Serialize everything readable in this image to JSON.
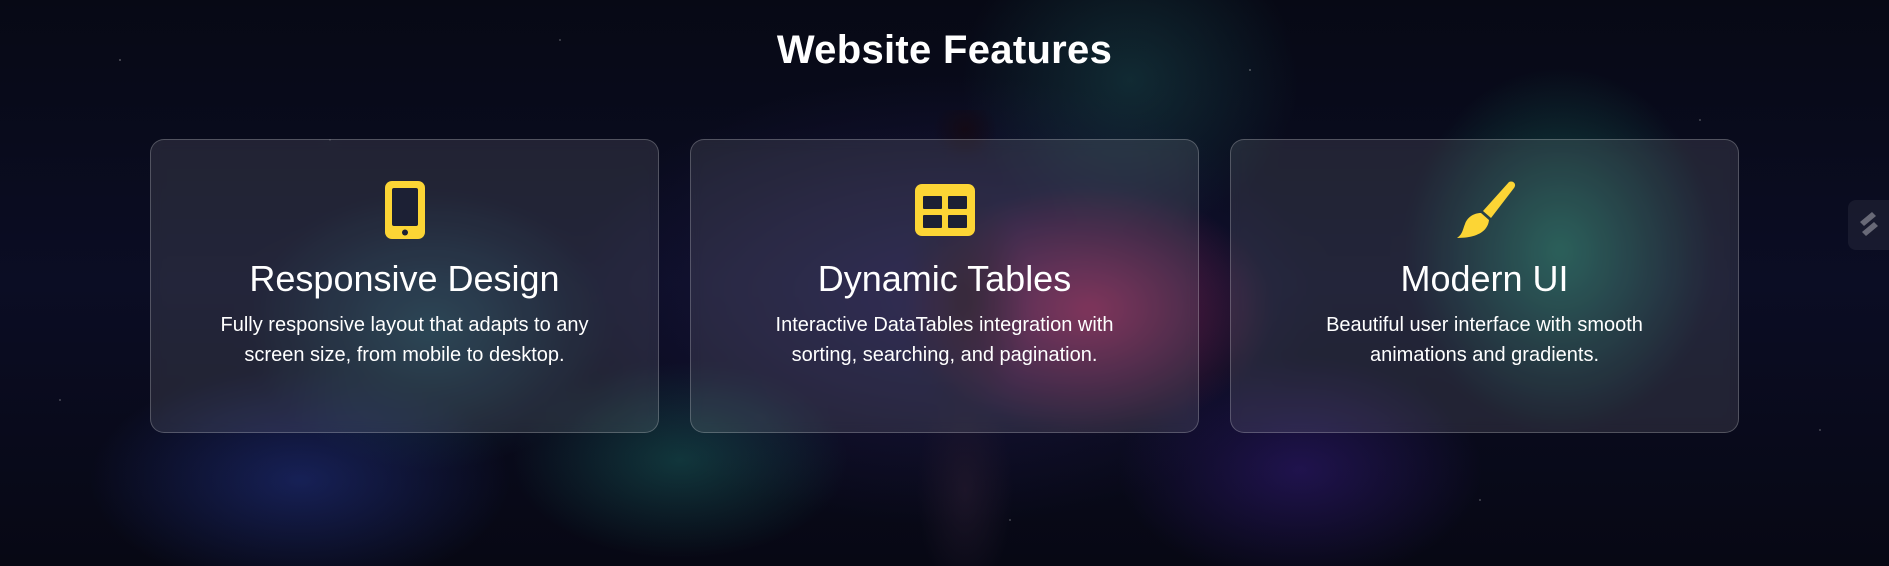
{
  "page": {
    "title": "Website Features"
  },
  "accent_color": "#fcd535",
  "features": [
    {
      "icon": "mobile-icon",
      "title": "Responsive Design",
      "desc_line1": "Fully responsive layout that adapts to any",
      "desc_line2": "screen size, from mobile to desktop."
    },
    {
      "icon": "table-icon",
      "title": "Dynamic Tables",
      "desc_line1": "Interactive DataTables integration with",
      "desc_line2": "sorting, searching, and pagination."
    },
    {
      "icon": "paintbrush-icon",
      "title": "Modern UI",
      "desc_line1": "Beautiful user interface with smooth",
      "desc_line2": "animations and gradients."
    }
  ],
  "side_widget": {
    "icon": "slider-icon"
  }
}
